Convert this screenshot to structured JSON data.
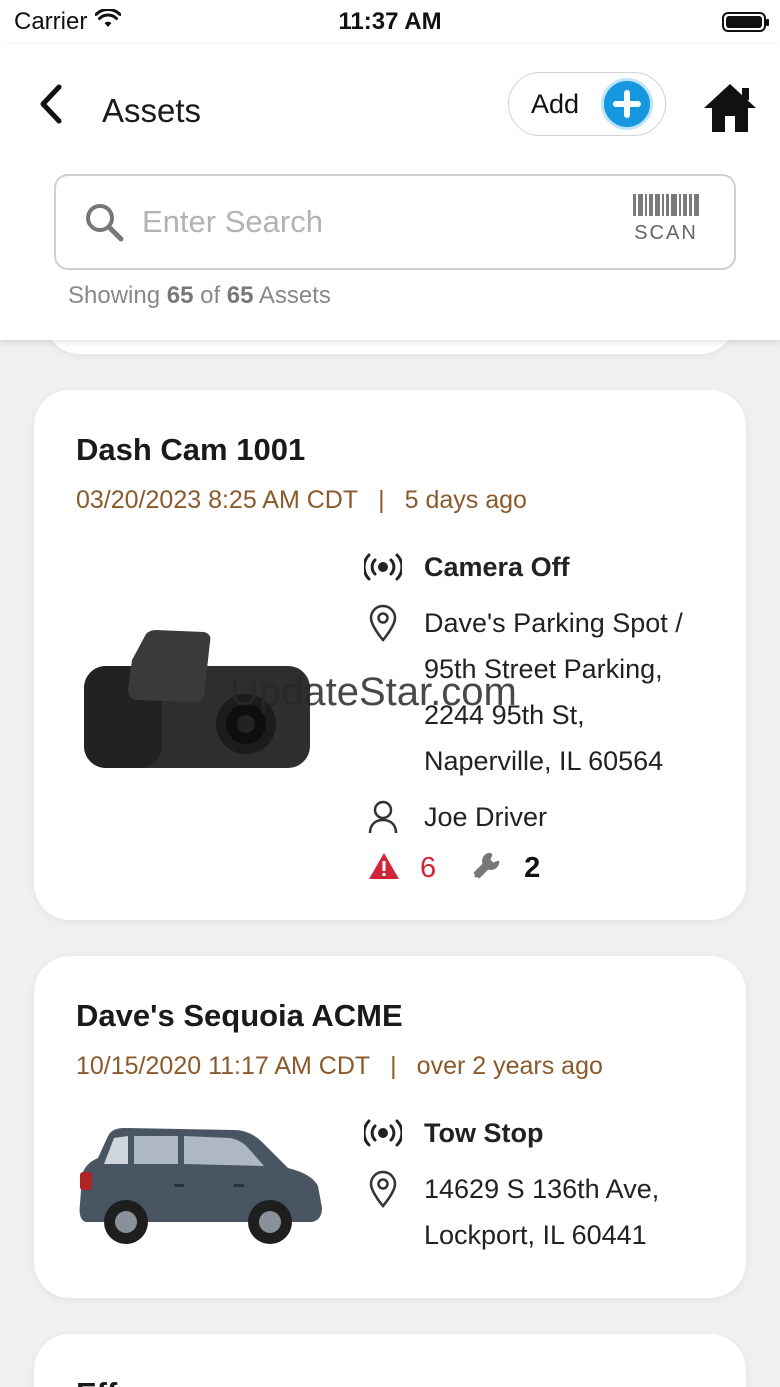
{
  "status_bar": {
    "carrier": "Carrier",
    "time": "11:37 AM"
  },
  "header": {
    "title": "Assets",
    "add_label": "Add",
    "search_placeholder": "Enter Search",
    "scan_label": "SCAN",
    "showing_prefix": "Showing",
    "showing_count": "65",
    "showing_of": "of",
    "showing_total": "65",
    "showing_suffix": "Assets"
  },
  "assets": [
    {
      "name": "Dash Cam 1001",
      "datetime": "03/20/2023 8:25 AM CDT",
      "separator": "|",
      "relative": "5 days ago",
      "status": "Camera Off",
      "address_lines": [
        "Dave's Parking Spot /",
        "95th Street Parking,",
        "2244 95th St,",
        "Naperville, IL 60564"
      ],
      "driver": "Joe Driver",
      "alerts": "6",
      "maintenance": "2"
    },
    {
      "name": "Dave's Sequoia ACME",
      "datetime": "10/15/2020 11:17 AM CDT",
      "separator": "|",
      "relative": "over 2 years ago",
      "status": "Tow Stop",
      "address_lines": [
        "14629 S 136th Ave,",
        "Lockport, IL 60441"
      ]
    },
    {
      "name": "Eff"
    }
  ],
  "watermark": "UpdateStar.com",
  "colors": {
    "accent": "#1598e0",
    "meta": "#8b5a2b",
    "alert": "#d0263a"
  },
  "icons": [
    "wifi-icon",
    "battery-icon",
    "back-chevron-icon",
    "plus-icon",
    "home-icon",
    "search-icon",
    "barcode-icon",
    "signal-icon",
    "location-pin-icon",
    "person-icon",
    "warning-icon",
    "wrench-icon"
  ]
}
